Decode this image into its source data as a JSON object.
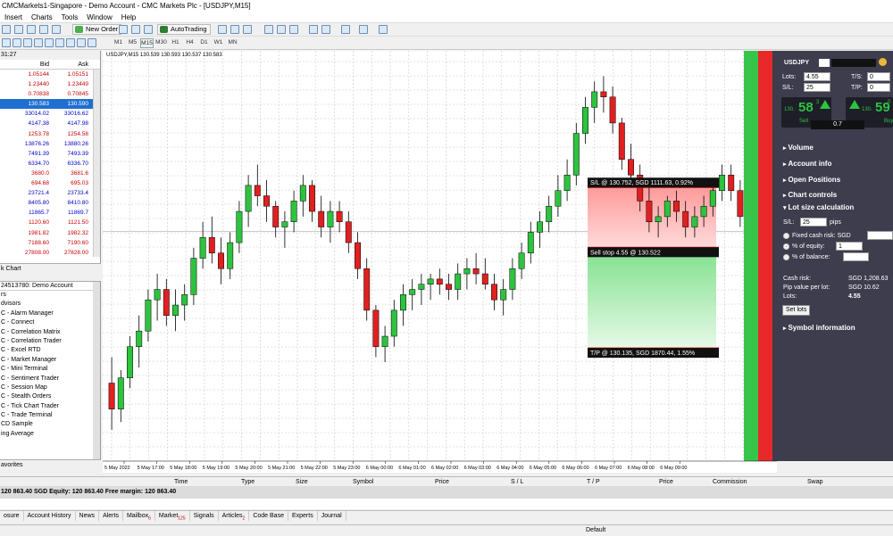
{
  "window_title": "CMCMarkets1-Singapore - Demo Account - CMC Markets Plc - [USDJPY,M15]",
  "menu": [
    "Insert",
    "Charts",
    "Tools",
    "Window",
    "Help"
  ],
  "toolbar": {
    "new_order": "New Order",
    "auto_trading": "AutoTrading"
  },
  "timeframes": [
    "M1",
    "M5",
    "M15",
    "M30",
    "H1",
    "H4",
    "D1",
    "W1",
    "MN"
  ],
  "selected_timeframe": "M15",
  "market_watch": {
    "time": "31:27",
    "bid_header": "Bid",
    "ask_header": "Ask",
    "rows": [
      {
        "bid": "1.05144",
        "ask": "1.05151",
        "color": "red"
      },
      {
        "bid": "1.23440",
        "ask": "1.23449",
        "color": "red"
      },
      {
        "bid": "0.70838",
        "ask": "0.70845",
        "color": "red"
      },
      {
        "bid": "130.583",
        "ask": "130.590",
        "color": "sel"
      },
      {
        "bid": "33014.02",
        "ask": "33016.62",
        "color": "blue"
      },
      {
        "bid": "4147.38",
        "ask": "4147.98",
        "color": "blue"
      },
      {
        "bid": "1253.78",
        "ask": "1254.58",
        "color": "red"
      },
      {
        "bid": "13876.26",
        "ask": "13880.26",
        "color": "blue"
      },
      {
        "bid": "7491.39",
        "ask": "7493.39",
        "color": "blue"
      },
      {
        "bid": "6334.70",
        "ask": "6336.70",
        "color": "blue"
      },
      {
        "bid": "3680.0",
        "ask": "3681.6",
        "color": "red"
      },
      {
        "bid": "694.68",
        "ask": "695.03",
        "color": "red"
      },
      {
        "bid": "23721.4",
        "ask": "23733.4",
        "color": "blue"
      },
      {
        "bid": "8405.80",
        "ask": "8410.80",
        "color": "blue"
      },
      {
        "bid": "11865.7",
        "ask": "11869.7",
        "color": "blue"
      },
      {
        "bid": "1120.60",
        "ask": "1121.50",
        "color": "red"
      },
      {
        "bid": "1981.82",
        "ask": "1982.32",
        "color": "red"
      },
      {
        "bid": "7188.60",
        "ask": "7190.60",
        "color": "red"
      },
      {
        "bid": "27808.00",
        "ask": "27828.00",
        "color": "red"
      }
    ],
    "tab": "k Chart"
  },
  "navigator": {
    "title": "24513780: Demo Account",
    "items": [
      "rs",
      "dvisors",
      "C - Alarm Manager",
      "C - Connect",
      "C - Correlation Matrix",
      "C - Correlation Trader",
      "C - Excel RTD",
      "C - Market Manager",
      "C - Mini Terminal",
      "C - Sentiment Trader",
      "C - Session Map",
      "C - Stealth Orders",
      "C - Tick Chart Trader",
      "C - Trade Terminal",
      "CD Sample",
      "ing Average"
    ],
    "tab": "avorites"
  },
  "chart": {
    "title": "USDJPY,M15  130.539 130.593 130.537 130.583",
    "time_labels": [
      "5 May 2022",
      "5 May 17:00",
      "5 May 18:00",
      "5 May 19:00",
      "5 May 20:00",
      "5 May 21:00",
      "5 May 22:00",
      "5 May 23:00",
      "6 May 00:00",
      "6 May 01:00",
      "6 May 02:00",
      "6 May 03:00",
      "6 May 04:00",
      "6 May 05:00",
      "6 May 06:00",
      "6 May 07:00",
      "6 May 08:00",
      "6 May 09:00"
    ],
    "sl_label": "S/L @ 130.752, SGD 1111.63, 0.92%",
    "entry_label": "Sell stop 4.55 @ 130.522",
    "tp_label": "T/P @ 130.135, SGD 1870.44, 1.55%",
    "bull_color": "#2dc33f",
    "bear_color": "#e02020"
  },
  "chart_data": {
    "type": "candlestick",
    "ohlc": [
      [
        130.0,
        130.1,
        129.82,
        129.9
      ],
      [
        129.9,
        130.05,
        129.85,
        130.02
      ],
      [
        130.02,
        130.18,
        129.98,
        130.14
      ],
      [
        130.14,
        130.26,
        130.06,
        130.2
      ],
      [
        130.2,
        130.36,
        130.16,
        130.32
      ],
      [
        130.32,
        130.42,
        130.24,
        130.36
      ],
      [
        130.36,
        130.4,
        130.22,
        130.26
      ],
      [
        130.26,
        130.36,
        130.2,
        130.3
      ],
      [
        130.3,
        130.38,
        130.24,
        130.34
      ],
      [
        130.34,
        130.52,
        130.3,
        130.48
      ],
      [
        130.48,
        130.62,
        130.44,
        130.56
      ],
      [
        130.56,
        130.64,
        130.46,
        130.5
      ],
      [
        130.5,
        130.56,
        130.38,
        130.44
      ],
      [
        130.44,
        130.58,
        130.4,
        130.54
      ],
      [
        130.54,
        130.7,
        130.5,
        130.66
      ],
      [
        130.66,
        130.8,
        130.6,
        130.76
      ],
      [
        130.76,
        130.84,
        130.68,
        130.72
      ],
      [
        130.72,
        130.78,
        130.62,
        130.68
      ],
      [
        130.68,
        130.7,
        130.56,
        130.6
      ],
      [
        130.6,
        130.66,
        130.52,
        130.62
      ],
      [
        130.62,
        130.74,
        130.58,
        130.7
      ],
      [
        130.7,
        130.8,
        130.64,
        130.76
      ],
      [
        130.76,
        130.78,
        130.62,
        130.66
      ],
      [
        130.66,
        130.72,
        130.56,
        130.6
      ],
      [
        130.6,
        130.7,
        130.54,
        130.66
      ],
      [
        130.66,
        130.7,
        130.58,
        130.62
      ],
      [
        130.62,
        130.66,
        130.5,
        130.54
      ],
      [
        130.54,
        130.58,
        130.4,
        130.44
      ],
      [
        130.44,
        130.48,
        130.24,
        130.28
      ],
      [
        130.28,
        130.3,
        130.1,
        130.14
      ],
      [
        130.14,
        130.22,
        130.08,
        130.18
      ],
      [
        130.18,
        130.32,
        130.14,
        130.28
      ],
      [
        130.28,
        130.38,
        130.22,
        130.34
      ],
      [
        130.34,
        130.4,
        130.28,
        130.36
      ],
      [
        130.36,
        130.42,
        130.3,
        130.38
      ],
      [
        130.38,
        130.42,
        130.32,
        130.4
      ],
      [
        130.4,
        130.44,
        130.34,
        130.38
      ],
      [
        130.38,
        130.42,
        130.32,
        130.36
      ],
      [
        130.36,
        130.46,
        130.32,
        130.42
      ],
      [
        130.42,
        130.48,
        130.36,
        130.44
      ],
      [
        130.44,
        130.5,
        130.38,
        130.42
      ],
      [
        130.42,
        130.48,
        130.36,
        130.38
      ],
      [
        130.38,
        130.42,
        130.28,
        130.32
      ],
      [
        130.32,
        130.4,
        130.26,
        130.36
      ],
      [
        130.36,
        130.48,
        130.32,
        130.44
      ],
      [
        130.44,
        130.54,
        130.4,
        130.5
      ],
      [
        130.5,
        130.62,
        130.46,
        130.58
      ],
      [
        130.58,
        130.66,
        130.52,
        130.62
      ],
      [
        130.62,
        130.72,
        130.58,
        130.68
      ],
      [
        130.68,
        130.8,
        130.64,
        130.74
      ],
      [
        130.74,
        130.86,
        130.7,
        130.8
      ],
      [
        130.8,
        131.0,
        130.76,
        130.96
      ],
      [
        130.96,
        131.1,
        130.92,
        131.06
      ],
      [
        131.06,
        131.16,
        131.0,
        131.12
      ],
      [
        131.12,
        131.18,
        131.04,
        131.1
      ],
      [
        131.1,
        131.14,
        130.96,
        131.0
      ],
      [
        131.0,
        131.02,
        130.82,
        130.86
      ],
      [
        130.86,
        130.92,
        130.76,
        130.8
      ],
      [
        130.8,
        130.84,
        130.66,
        130.7
      ],
      [
        130.7,
        130.76,
        130.58,
        130.62
      ],
      [
        130.62,
        130.68,
        130.56,
        130.64
      ],
      [
        130.64,
        130.72,
        130.6,
        130.7
      ],
      [
        130.7,
        130.74,
        130.62,
        130.66
      ],
      [
        130.66,
        130.7,
        130.56,
        130.6
      ],
      [
        130.6,
        130.68,
        130.56,
        130.64
      ],
      [
        130.64,
        130.72,
        130.6,
        130.68
      ],
      [
        130.68,
        130.78,
        130.64,
        130.74
      ],
      [
        130.74,
        130.84,
        130.7,
        130.8
      ],
      [
        130.8,
        130.84,
        130.7,
        130.74
      ],
      [
        130.74,
        130.78,
        130.6,
        130.64
      ],
      [
        130.64,
        130.66,
        130.56,
        130.58
      ]
    ],
    "ylim": [
      129.7,
      131.25
    ]
  },
  "panel": {
    "symbol": "USDJPY",
    "lots_label": "Lots:",
    "lots_value": "4.55",
    "ts_label": "T/S:",
    "ts_value": "0",
    "sl_label": "S/L:",
    "sl_value": "25",
    "tp_label": "T/P:",
    "tp_value": "0",
    "sell_price_small": "130.",
    "sell_price_big": "58",
    "sell_price_sup": "3",
    "buy_price_small": "130.",
    "buy_price_big": "59",
    "buy_price_sup": "0",
    "sell_label": "Sell",
    "buy_label": "Buy",
    "spread": "0.7",
    "sections": [
      "Volume",
      "Account info",
      "Open Positions",
      "Chart controls"
    ],
    "lot_calc_title": "Lot size calculation",
    "calc_sl_label": "S/L:",
    "calc_sl_value": "25",
    "calc_sl_unit": "pips",
    "fixed_cash_label": "Fixed cash risk: SGD",
    "equity_label": "% of equity:",
    "equity_value": "1",
    "balance_label": "% of balance:",
    "cash_risk_label": "Cash risk:",
    "cash_risk_value": "SGD 1,208.63",
    "pip_value_label": "Pip value per lot:",
    "pip_value_value": "SGD 10.62",
    "result_lots_label": "Lots:",
    "result_lots_value": "4.55",
    "set_lots_button": "Set lots",
    "symbol_info": "Symbol information"
  },
  "terminal": {
    "columns": [
      "Time",
      "Type",
      "Size",
      "Symbol",
      "Price",
      "S / L",
      "T / P",
      "Price",
      "Commission",
      "Swap"
    ],
    "balance_row": "120 863.40 SGD  Equity: 120 863.40  Free margin: 120 863.40"
  },
  "tabs": [
    {
      "label": "osure"
    },
    {
      "label": "Account History"
    },
    {
      "label": "News"
    },
    {
      "label": "Alerts"
    },
    {
      "label": "Mailbox",
      "badge": "6"
    },
    {
      "label": "Market",
      "badge": "125"
    },
    {
      "label": "Signals"
    },
    {
      "label": "Articles",
      "badge": "2"
    },
    {
      "label": "Code Base"
    },
    {
      "label": "Experts"
    },
    {
      "label": "Journal"
    }
  ],
  "status": {
    "profile": "Default"
  }
}
